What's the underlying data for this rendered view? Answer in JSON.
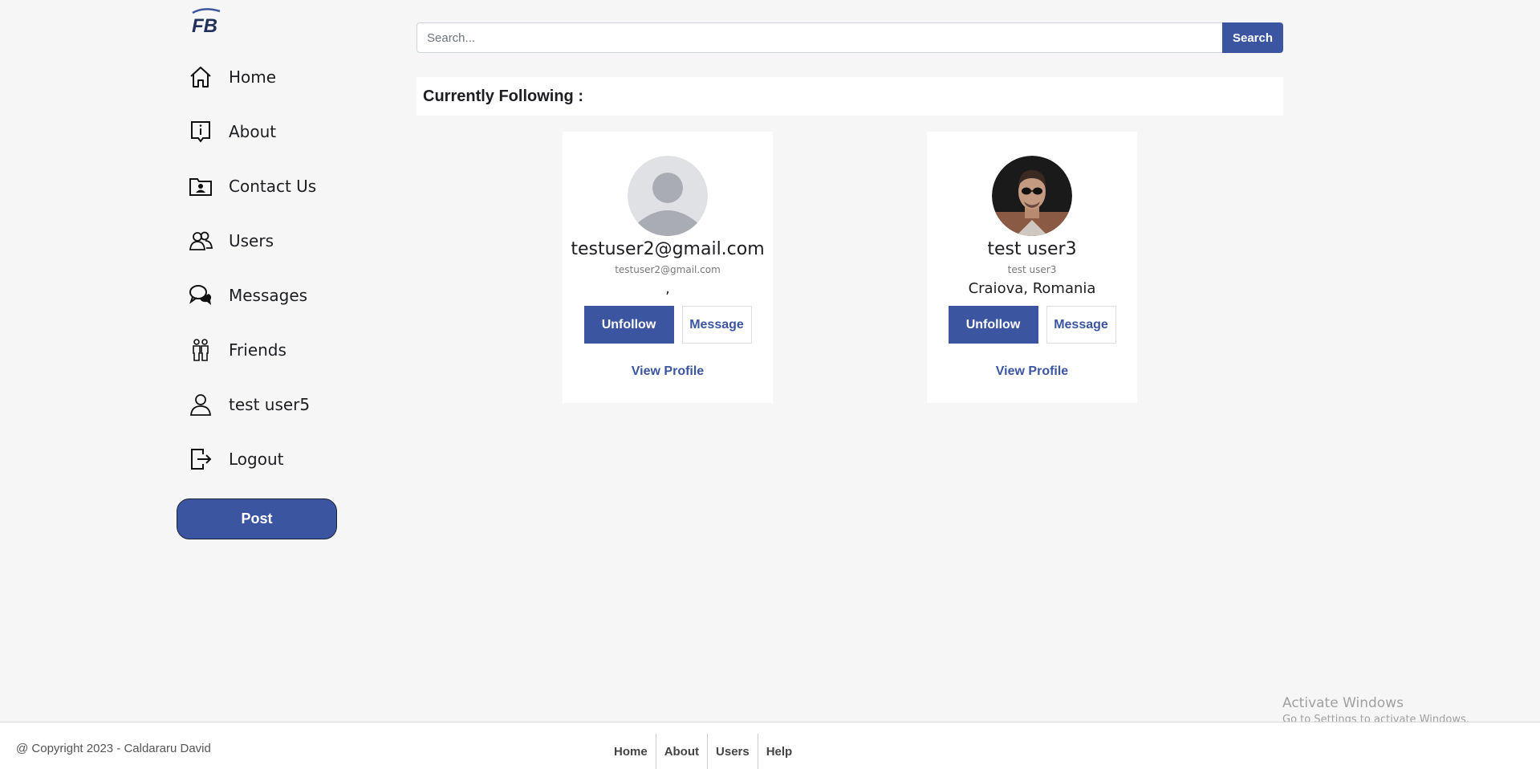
{
  "brand": {
    "logo_text": "FB",
    "color": "#3b55a0"
  },
  "sidebar": {
    "items": [
      {
        "label": "Home",
        "icon": "home-icon"
      },
      {
        "label": "About",
        "icon": "info-icon"
      },
      {
        "label": "Contact Us",
        "icon": "contact-card-icon"
      },
      {
        "label": "Users",
        "icon": "users-icon"
      },
      {
        "label": "Messages",
        "icon": "chat-bubbles-icon"
      },
      {
        "label": "Friends",
        "icon": "friends-icon"
      },
      {
        "label": "test user5",
        "icon": "user-icon"
      },
      {
        "label": "Logout",
        "icon": "logout-icon"
      }
    ],
    "post_label": "Post"
  },
  "search": {
    "placeholder": "Search...",
    "value": "",
    "button_label": "Search"
  },
  "following": {
    "title": "Currently Following :",
    "cards": [
      {
        "name": "testuser2@gmail.com",
        "subtitle": "testuser2@gmail.com",
        "location": ",",
        "avatar": "default-avatar-icon",
        "unfollow_label": "Unfollow",
        "message_label": "Message",
        "view_profile_label": "View Profile"
      },
      {
        "name": "test user3",
        "subtitle": "test user3",
        "location": "Craiova, Romania",
        "avatar": "profile-photo",
        "unfollow_label": "Unfollow",
        "message_label": "Message",
        "view_profile_label": "View Profile"
      }
    ]
  },
  "footer": {
    "copyright": "@ Copyright 2023 - Caldararu David",
    "links": [
      "Home",
      "About",
      "Users",
      "Help"
    ]
  },
  "watermark": {
    "title": "Activate Windows",
    "subtitle": "Go to Settings to activate Windows."
  }
}
